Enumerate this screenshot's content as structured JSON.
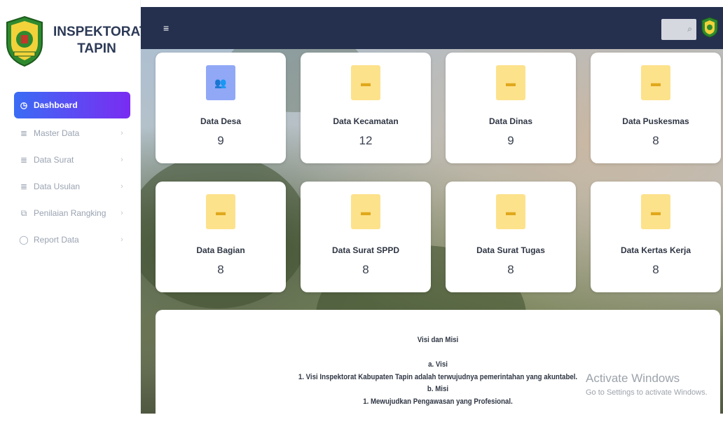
{
  "brand": {
    "line1": "INSPEKTORAT",
    "line2": "TAPIN"
  },
  "sidebar": {
    "items": [
      {
        "label": "Dashboard",
        "icon": "clock-icon",
        "active": true
      },
      {
        "label": "Master Data",
        "icon": "database-icon",
        "chevron": "›"
      },
      {
        "label": "Data Surat",
        "icon": "database-icon",
        "chevron": "›"
      },
      {
        "label": "Data Usulan",
        "icon": "database-icon",
        "chevron": "›"
      },
      {
        "label": "Penilaian Rangking",
        "icon": "copy-icon",
        "chevron": "›"
      },
      {
        "label": "Report Data",
        "icon": "chat-icon",
        "chevron": "›"
      }
    ]
  },
  "topbar": {
    "menu_icon": "≡",
    "search_icon": "⌕"
  },
  "cards": [
    {
      "title": "Data Desa",
      "value": "9",
      "icon": "users-icon",
      "color": "blue"
    },
    {
      "title": "Data Kecamatan",
      "value": "12",
      "icon": "car-icon",
      "color": "yellow"
    },
    {
      "title": "Data Dinas",
      "value": "9",
      "icon": "car-icon",
      "color": "yellow"
    },
    {
      "title": "Data Puskesmas",
      "value": "8",
      "icon": "car-icon",
      "color": "yellow"
    },
    {
      "title": "Data Bagian",
      "value": "8",
      "icon": "car-icon",
      "color": "yellow"
    },
    {
      "title": "Data Surat SPPD",
      "value": "8",
      "icon": "car-icon",
      "color": "yellow"
    },
    {
      "title": "Data Surat Tugas",
      "value": "8",
      "icon": "car-icon",
      "color": "yellow"
    },
    {
      "title": "Data Kertas Kerja",
      "value": "8",
      "icon": "car-icon",
      "color": "yellow"
    }
  ],
  "visi_misi": {
    "heading": "Visi dan Misi",
    "visi_label": "a. Visi",
    "visi_1": "1. Visi Inspektorat Kabupaten Tapin adalah terwujudnya pemerintahan yang akuntabel.",
    "misi_label": "b. Misi",
    "misi_1": "1. Mewujudkan Pengawasan yang Profesional."
  },
  "watermark": {
    "title": "Activate Windows",
    "subtitle": "Go to Settings to activate Windows."
  },
  "colors": {
    "topbar": "#25304f",
    "accent_start": "#3b6cf4",
    "accent_end": "#7a2cf2",
    "icon_yellow": "#fde28c",
    "icon_blue": "#90a8f6"
  }
}
